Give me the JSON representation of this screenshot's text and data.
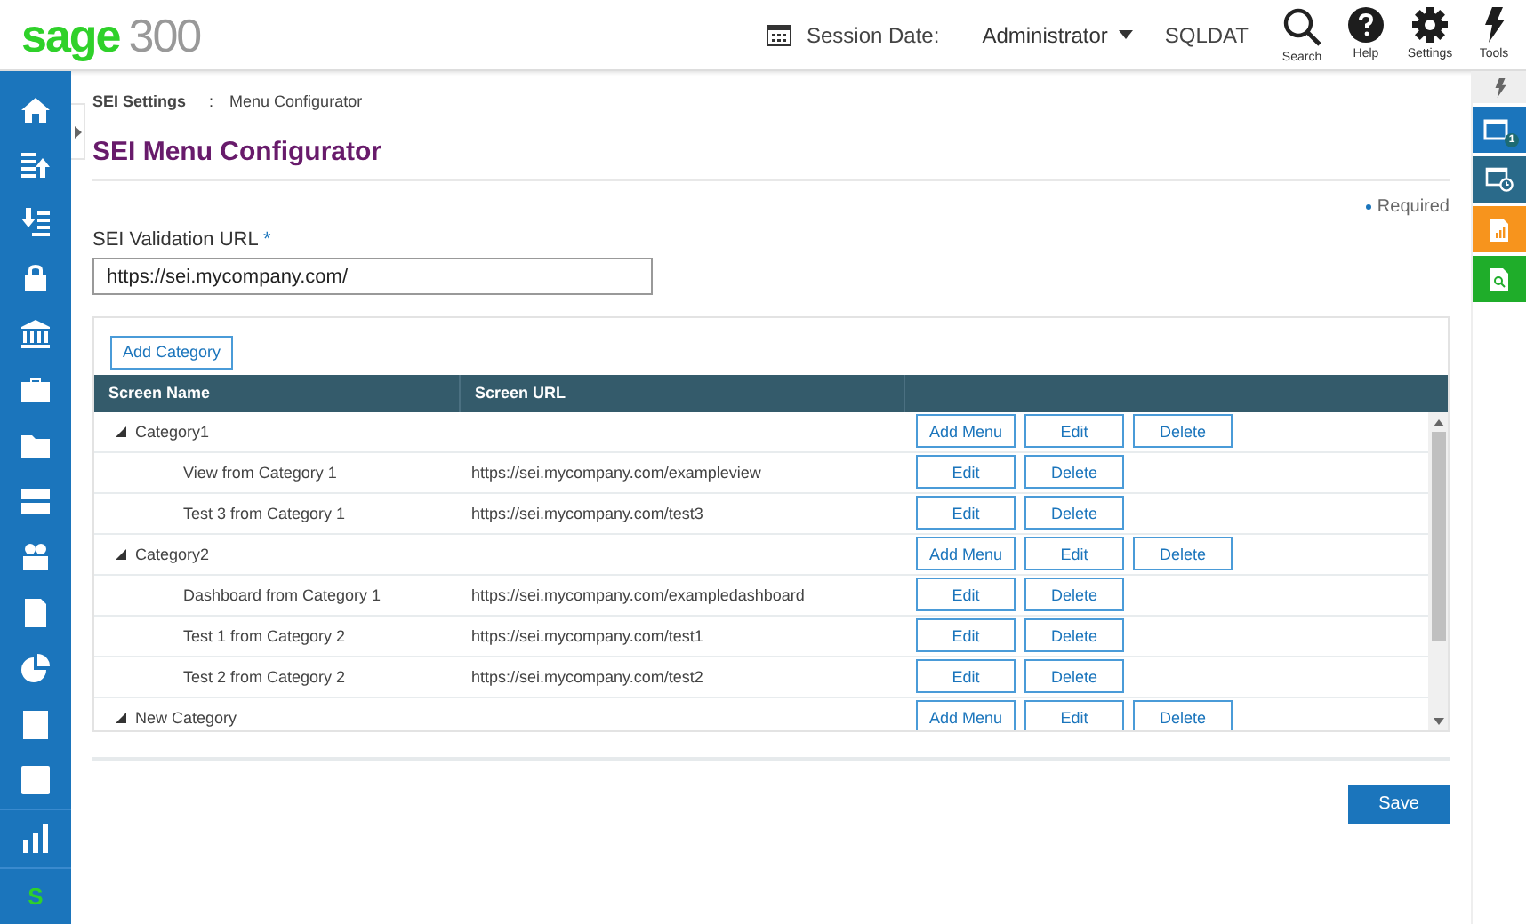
{
  "logo": {
    "brand": "sage",
    "product": "300"
  },
  "header": {
    "session_label": "Session Date:",
    "user": "Administrator",
    "company": "SQLDAT",
    "tools": [
      {
        "kind": "search",
        "label": "Search"
      },
      {
        "kind": "help",
        "label": "Help"
      },
      {
        "kind": "settings",
        "label": "Settings"
      },
      {
        "kind": "tools",
        "label": "Tools"
      }
    ]
  },
  "sidebar": {
    "bottom_text": "S"
  },
  "right_panel": {
    "badge": "1"
  },
  "breadcrumb": {
    "parent": "SEI Settings",
    "separator": ":",
    "current": "Menu Configurator"
  },
  "title": "SEI Menu Configurator",
  "required_note": "Required",
  "url_field": {
    "label": "SEI Validation URL",
    "required_mark": "*",
    "value": "https://sei.mycompany.com/"
  },
  "add_category_button": "Add Category",
  "table": {
    "columns": [
      "Screen Name",
      "Screen URL"
    ],
    "rows": [
      {
        "name": "Category1",
        "expanded": true,
        "buttons": [
          "Add Menu",
          "Edit",
          "Delete"
        ],
        "children": [
          {
            "name": "View from Category 1",
            "url": "https://sei.mycompany.com/exampleview",
            "buttons": [
              "Edit",
              "Delete"
            ]
          },
          {
            "name": "Test 3 from Category 1",
            "url": "https://sei.mycompany.com/test3",
            "buttons": [
              "Edit",
              "Delete"
            ]
          }
        ]
      },
      {
        "name": "Category2",
        "expanded": true,
        "buttons": [
          "Add Menu",
          "Edit",
          "Delete"
        ],
        "children": [
          {
            "name": "Dashboard from Category 1",
            "url": "https://sei.mycompany.com/exampledashboard",
            "buttons": [
              "Edit",
              "Delete"
            ]
          },
          {
            "name": "Test 1 from Category 2",
            "url": "https://sei.mycompany.com/test1",
            "buttons": [
              "Edit",
              "Delete"
            ]
          },
          {
            "name": "Test 2 from Category 2",
            "url": "https://sei.mycompany.com/test2",
            "buttons": [
              "Edit",
              "Delete"
            ]
          }
        ]
      },
      {
        "name": "New Category",
        "expanded": true,
        "buttons": [
          "Add Menu",
          "Edit",
          "Delete"
        ],
        "children": []
      }
    ]
  },
  "save_button": "Save"
}
